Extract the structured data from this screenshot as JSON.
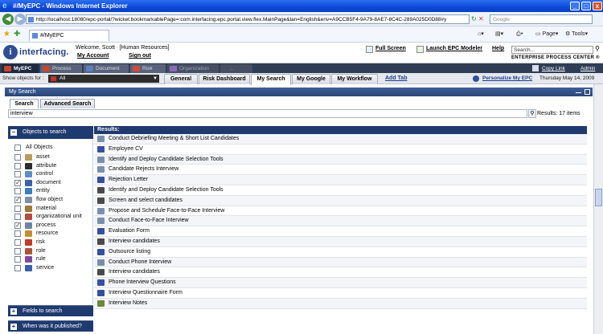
{
  "window": {
    "title": "#/MyEPC - Windows Internet Explorer"
  },
  "browser": {
    "address": "http://localhost:18080/epc-portal/?wicket:bookmarkablePage=:com.interfacing.epc.portal.view.flex.MainPage&lan=English&env=A9CCB5F4-9A79-8AE7-8C4C-289A025D0D88#y",
    "search_placeholder": "Google",
    "tab_label": "#/MyEPC",
    "page_menu": "Page",
    "tools_menu": "Tools"
  },
  "header": {
    "logo_text": "interfacing.",
    "welcome": "Welcome, Scott",
    "role": "[Human Resources]",
    "my_account": "My Account",
    "sign_out": "Sign out",
    "full_screen": "Full Screen",
    "launch_modeler": "Launch EPC Modeler",
    "help": "Help",
    "search_value": "Search...",
    "brand": "ENTERPRISE PROCESS CENTER",
    "brand_mark": "®"
  },
  "module_tabs": [
    {
      "label": "MyEPC",
      "color": "#c8462d"
    },
    {
      "label": "Process",
      "color": "#c8462d"
    },
    {
      "label": "Document",
      "color": "#5a7fc2"
    },
    {
      "label": "Risk",
      "color": "#d04a3a"
    },
    {
      "label": "Organization",
      "color": "#8a6bb5"
    },
    {
      "label": "...",
      "color": "#7a8399"
    }
  ],
  "module_links": {
    "copy_link": "Copy Link",
    "admin": "Admin"
  },
  "subnav": {
    "show_objects_label": "Show objects for :",
    "show_objects_value": "All",
    "tabs": [
      "General",
      "Risk Dashboard",
      "My Search",
      "My Google",
      "My Workflow"
    ],
    "active_tab": "My Search",
    "add_tab": "Add Tab",
    "personalize": "Personalize My EPC",
    "date": "Thursday May 14, 2009"
  },
  "panel": {
    "title": "My Search",
    "tabs": [
      "Search",
      "Advanced Search"
    ],
    "query": "interview",
    "results_count": "Results: 17 items"
  },
  "objects_panel": {
    "title": "Objects to search",
    "all_label": "All Objects",
    "items": [
      {
        "label": "asset",
        "checked": false,
        "color": "#b89a5a"
      },
      {
        "label": "attribute",
        "checked": false,
        "color": "#2d2d2d"
      },
      {
        "label": "control",
        "checked": false,
        "color": "#5f8fc7"
      },
      {
        "label": "document",
        "checked": true,
        "color": "#3f5fa8"
      },
      {
        "label": "entity",
        "checked": false,
        "color": "#3a7fc1"
      },
      {
        "label": "flow object",
        "checked": true,
        "color": "#7e8fa6"
      },
      {
        "label": "material",
        "checked": false,
        "color": "#9d7a3a"
      },
      {
        "label": "organizational unit",
        "checked": false,
        "color": "#b84a3a"
      },
      {
        "label": "process",
        "checked": true,
        "color": "#6b84a8"
      },
      {
        "label": "resource",
        "checked": false,
        "color": "#c2902f"
      },
      {
        "label": "risk",
        "checked": false,
        "color": "#c23a2a"
      },
      {
        "label": "role",
        "checked": false,
        "color": "#b0523a"
      },
      {
        "label": "rule",
        "checked": false,
        "color": "#7a4a9a"
      },
      {
        "label": "service",
        "checked": false,
        "color": "#3a5fa8"
      }
    ],
    "footers": [
      "Fields to search",
      "When was it published?"
    ]
  },
  "results": {
    "header": "Results:",
    "items": [
      {
        "label": "Conduct Debriefing Meeting & Short List Candidates",
        "kind": "process"
      },
      {
        "label": "Employee CV",
        "kind": "document"
      },
      {
        "label": "Identify and Deploy Candidate Selection Tools",
        "kind": "process"
      },
      {
        "label": "Candidate Rejects Interview",
        "kind": "process"
      },
      {
        "label": "Rejection Letter",
        "kind": "document"
      },
      {
        "label": "Identify and Deploy Candidate Selection Tools",
        "kind": "flow"
      },
      {
        "label": "Screen and select candidates",
        "kind": "flow"
      },
      {
        "label": "Propose and Schedule Face-to-Face Interview",
        "kind": "process"
      },
      {
        "label": "Conduct Face-to-Face Interview",
        "kind": "process"
      },
      {
        "label": "Evaluation Form",
        "kind": "document"
      },
      {
        "label": "Interview candidates",
        "kind": "flow"
      },
      {
        "label": "Outsource listing",
        "kind": "document"
      },
      {
        "label": "Conduct Phone Interview",
        "kind": "process"
      },
      {
        "label": "Interview candidates",
        "kind": "flow"
      },
      {
        "label": "Phone Interview Questions",
        "kind": "document"
      },
      {
        "label": "Interview Questionnaire Form",
        "kind": "document"
      },
      {
        "label": "Interview Notes",
        "kind": "note"
      }
    ]
  },
  "icon_colors": {
    "process": "#7a8fae",
    "document": "#3550a0",
    "flow": "#4a4a4a",
    "note": "#6a8a3a"
  }
}
